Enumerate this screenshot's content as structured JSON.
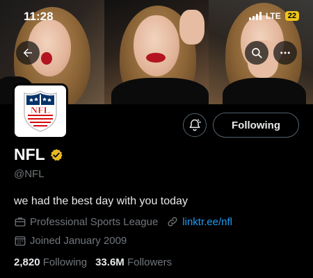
{
  "status_bar": {
    "time": "11:28",
    "network": "LTE",
    "battery": "22"
  },
  "profile": {
    "name": "NFL",
    "handle": "@NFL",
    "bio": "we had the best day with you today",
    "category": "Professional Sports League",
    "link": "linktr.ee/nfl",
    "joined": "Joined January 2009",
    "following_count": "2,820",
    "following_label": "Following",
    "followers_count": "33.6M",
    "followers_label": "Followers",
    "avatar_text": "NFL"
  },
  "actions": {
    "following_button": "Following"
  },
  "colors": {
    "accent_link": "#1d9bf0",
    "verified": "#e8b923",
    "secondary_text": "#71767b"
  },
  "icons": [
    "back-arrow-icon",
    "search-icon",
    "more-icon",
    "notification-bell-icon",
    "verified-badge-icon",
    "briefcase-icon",
    "link-icon",
    "calendar-icon"
  ]
}
